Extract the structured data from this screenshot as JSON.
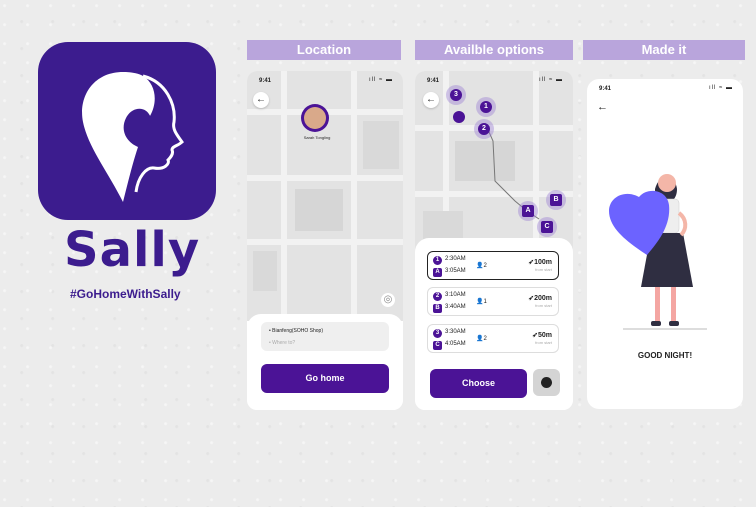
{
  "brand": {
    "name": "Sally",
    "hashtag": "#GoHomeWithSally",
    "color": "#3c1c8e"
  },
  "sections": [
    {
      "title": "Location"
    },
    {
      "title": "Availble options"
    },
    {
      "title": "Made it"
    }
  ],
  "status": {
    "time": "9:41",
    "icons": "ıll ≈ ▬"
  },
  "screen1": {
    "back": "←",
    "pin_name": "Sarah Tongling",
    "from": "• Bianfeng(SOHO Shop)",
    "to": "• Where to?",
    "button": "Go home",
    "locate": "◎"
  },
  "screen2": {
    "back": "←",
    "map_markers": [
      "3",
      "1",
      "2",
      "B",
      "A",
      "C"
    ],
    "options": [
      {
        "n": "1",
        "dep": "2:30AM",
        "l": "A",
        "arr": "3:05AM",
        "people": "2",
        "dist": "100m",
        "sub": "from start"
      },
      {
        "n": "2",
        "dep": "3:10AM",
        "l": "B",
        "arr": "3:40AM",
        "people": "1",
        "dist": "200m",
        "sub": "from start"
      },
      {
        "n": "3",
        "dep": "3:30AM",
        "l": "C",
        "arr": "4:05AM",
        "people": "2",
        "dist": "50m",
        "sub": "from start"
      }
    ],
    "button": "Choose"
  },
  "screen3": {
    "back": "←",
    "message": "GOOD NIGHT!",
    "heart_color": "#6c63ff"
  }
}
